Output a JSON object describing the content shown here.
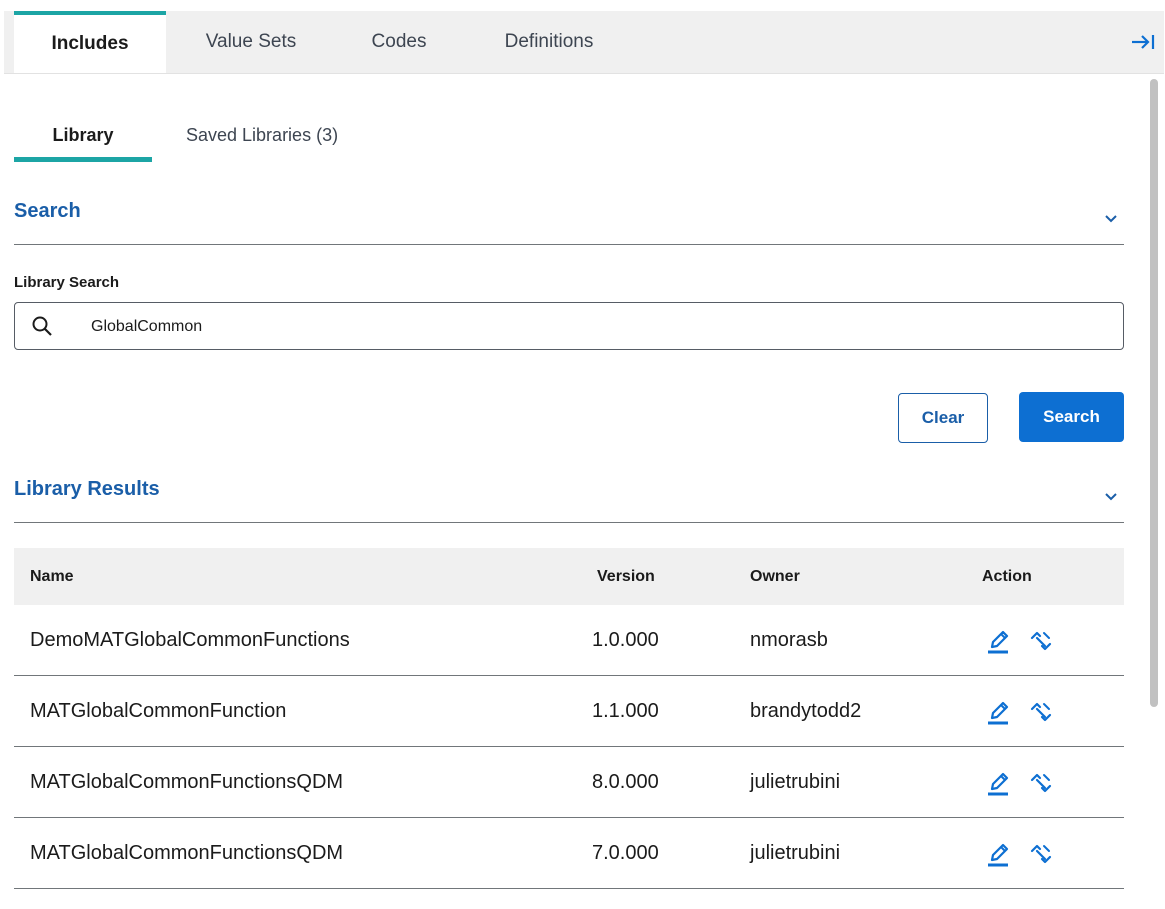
{
  "top_tabs": [
    {
      "label": "Includes",
      "active": true
    },
    {
      "label": "Value Sets",
      "active": false
    },
    {
      "label": "Codes",
      "active": false
    },
    {
      "label": "Definitions",
      "active": false
    }
  ],
  "sub_tabs": [
    {
      "label": "Library",
      "active": true
    },
    {
      "label": "Saved Libraries (3)",
      "active": false
    }
  ],
  "search_section": {
    "title": "Search",
    "field_label": "Library Search",
    "input_value": "GlobalCommon",
    "clear_label": "Clear",
    "search_label": "Search"
  },
  "results_section": {
    "title": "Library Results",
    "columns": [
      "Name",
      "Version",
      "Owner",
      "Action"
    ],
    "rows": [
      {
        "name": "DemoMATGlobalCommonFunctions",
        "version": "1.0.000",
        "owner": "nmorasb"
      },
      {
        "name": "MATGlobalCommonFunction",
        "version": "1.1.000",
        "owner": "brandytodd2"
      },
      {
        "name": "MATGlobalCommonFunctionsQDM",
        "version": "8.0.000",
        "owner": "julietrubini"
      },
      {
        "name": "MATGlobalCommonFunctionsQDM",
        "version": "7.0.000",
        "owner": "julietrubini"
      }
    ],
    "row_actions": [
      "edit-icon",
      "unlink-icon"
    ]
  },
  "colors": {
    "accent_teal": "#1ca5a5",
    "heading_blue": "#1a5ea8",
    "primary_button": "#0d6fd2"
  },
  "icons": {
    "collapse_panel": "arrow-right-to-line-icon",
    "section_toggle": "chevron-down-icon",
    "search": "search-icon"
  }
}
